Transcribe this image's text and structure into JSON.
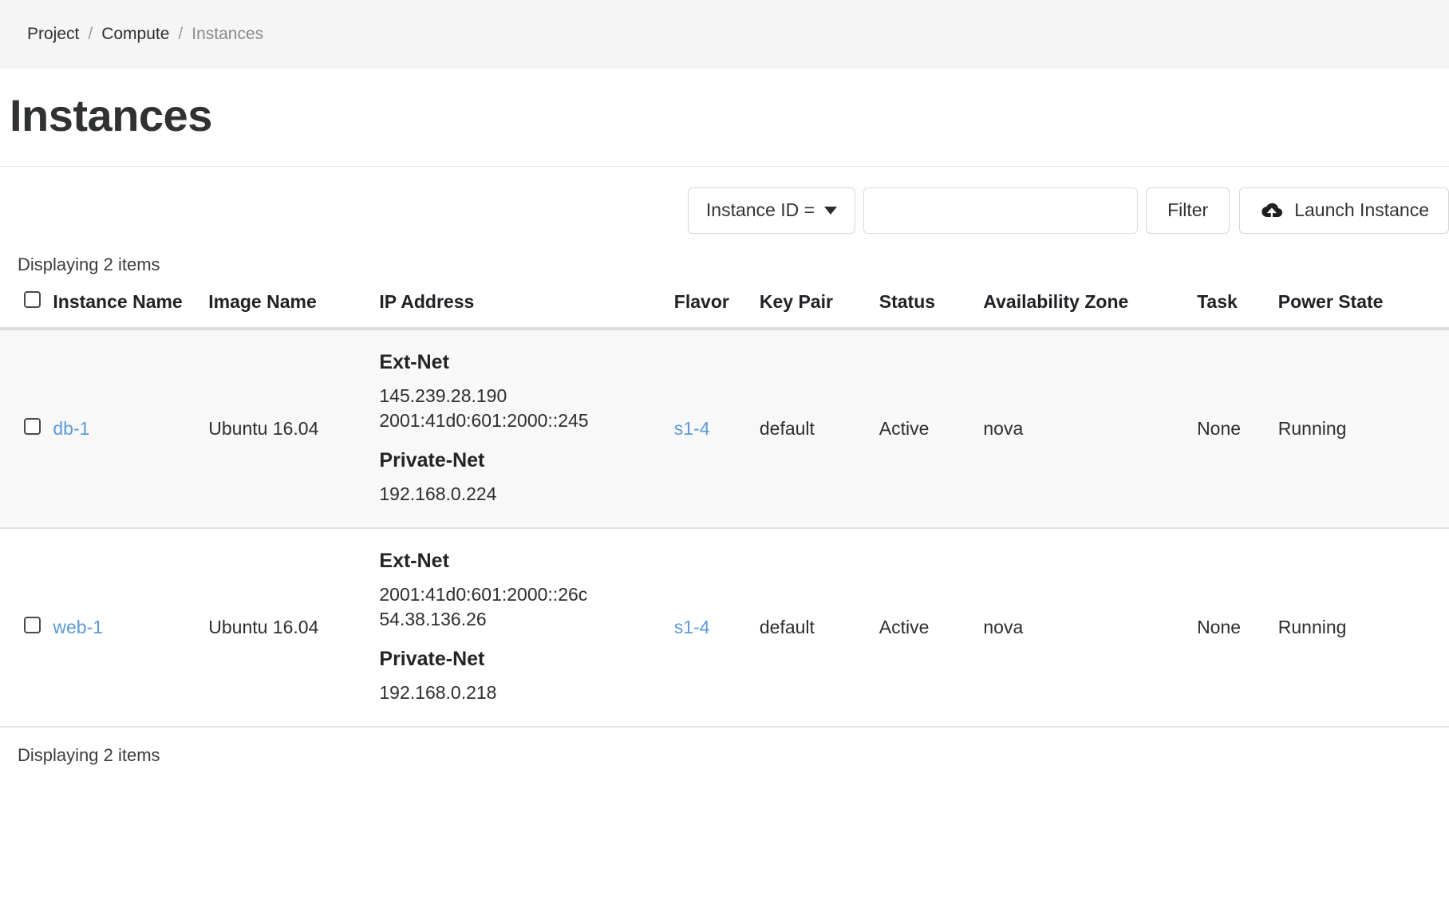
{
  "breadcrumb": {
    "items": [
      {
        "label": "Project",
        "current": false
      },
      {
        "label": "Compute",
        "current": false
      },
      {
        "label": "Instances",
        "current": true
      }
    ],
    "separator": "/"
  },
  "page": {
    "title": "Instances"
  },
  "toolbar": {
    "filter_field_label": "Instance ID =",
    "filter_input_value": "",
    "filter_input_placeholder": "",
    "filter_button_label": "Filter",
    "launch_button_label": "Launch Instance",
    "launch_button_icon": "cloud-upload-icon"
  },
  "table": {
    "count_top": "Displaying 2 items",
    "count_bottom": "Displaying 2 items",
    "columns": [
      "Instance Name",
      "Image Name",
      "IP Address",
      "Flavor",
      "Key Pair",
      "Status",
      "Availability Zone",
      "Task",
      "Power State"
    ],
    "rows": [
      {
        "instance_name": "db-1",
        "image_name": "Ubuntu 16.04",
        "networks": [
          {
            "name": "Ext-Net",
            "addresses": [
              "145.239.28.190",
              "2001:41d0:601:2000::245"
            ]
          },
          {
            "name": "Private-Net",
            "addresses": [
              "192.168.0.224"
            ]
          }
        ],
        "flavor": "s1-4",
        "key_pair": "default",
        "status": "Active",
        "availability_zone": "nova",
        "task": "None",
        "power_state": "Running"
      },
      {
        "instance_name": "web-1",
        "image_name": "Ubuntu 16.04",
        "networks": [
          {
            "name": "Ext-Net",
            "addresses": [
              "2001:41d0:601:2000::26c",
              "54.38.136.26"
            ]
          },
          {
            "name": "Private-Net",
            "addresses": [
              "192.168.0.218"
            ]
          }
        ],
        "flavor": "s1-4",
        "key_pair": "default",
        "status": "Active",
        "availability_zone": "nova",
        "task": "None",
        "power_state": "Running"
      }
    ]
  },
  "colors": {
    "link": "#5b9ad9",
    "breadcrumb_bg": "#f5f5f5",
    "row_alt_bg": "#f8f8f8",
    "text": "#2c2e30"
  }
}
